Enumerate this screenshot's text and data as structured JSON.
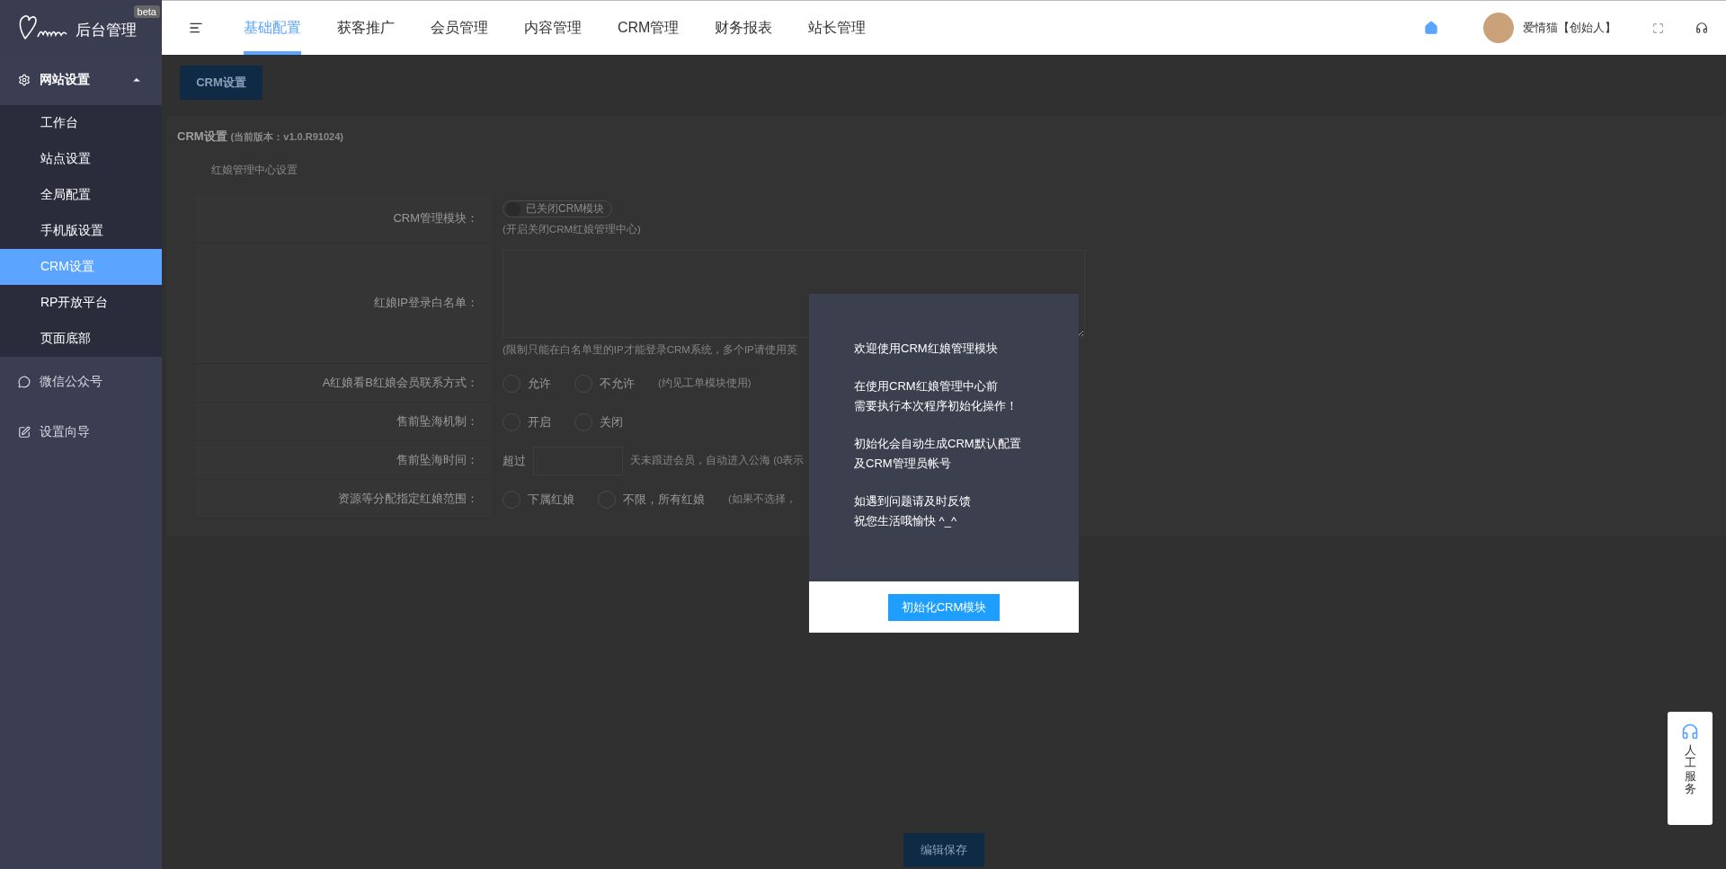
{
  "logo": {
    "text": "后台管理",
    "badge": "beta"
  },
  "top_nav": [
    {
      "label": "基础配置",
      "selected": true
    },
    {
      "label": "获客推广",
      "selected": false
    },
    {
      "label": "会员管理",
      "selected": false
    },
    {
      "label": "内容管理",
      "selected": false
    },
    {
      "label": "CRM管理",
      "selected": false
    },
    {
      "label": "财务报表",
      "selected": false
    },
    {
      "label": "站长管理",
      "selected": false
    }
  ],
  "user": {
    "name": "爱情猫【创始人】"
  },
  "sidebar": [
    {
      "label": "网站设置",
      "expanded": true,
      "children": [
        {
          "label": "工作台",
          "selected": false
        },
        {
          "label": "站点设置",
          "selected": false
        },
        {
          "label": "全局配置",
          "selected": false
        },
        {
          "label": "手机版设置",
          "selected": false
        },
        {
          "label": "CRM设置",
          "selected": true
        },
        {
          "label": "RP开放平台",
          "selected": false
        },
        {
          "label": "页面底部",
          "selected": false
        }
      ]
    },
    {
      "label": "微信公众号",
      "expanded": false
    },
    {
      "label": "设置向导",
      "expanded": false
    }
  ],
  "page_button": "CRM设置",
  "panel": {
    "title": "CRM设置",
    "version": "(当前版本：v1.0.R91024)",
    "tab": "红娘管理中心设置",
    "rows": [
      {
        "kind": "switch",
        "label": "CRM管理模块：",
        "switch_text": "已关闭CRM模块",
        "on": false,
        "hint": "(开启关闭CRM红娘管理中心)"
      },
      {
        "kind": "textarea",
        "label": "红娘IP登录白名单：",
        "hint": "(限制只能在白名单里的IP才能登录CRM系统，多个IP请使用英"
      },
      {
        "kind": "radio",
        "label": "A红娘看B红娘会员联系方式：",
        "options": [
          {
            "label": "允许",
            "selected": false
          },
          {
            "label": "不允许",
            "selected": false
          }
        ],
        "hint": "(约见工单模块使用)"
      },
      {
        "kind": "radio",
        "label": "售前坠海机制：",
        "options": [
          {
            "label": "开启",
            "selected": false
          },
          {
            "label": "关闭",
            "selected": false
          }
        ]
      },
      {
        "kind": "input",
        "label": "售前坠海时间：",
        "prefix": "超过",
        "hint": "天未跟进会员，自动进入公海 (0表示"
      },
      {
        "kind": "radio",
        "label": "资源等分配指定红娘范围：",
        "options": [
          {
            "label": "下属红娘",
            "selected": false
          },
          {
            "label": "不限，所有红娘",
            "selected": false
          }
        ],
        "hint": "(如果不选择，"
      }
    ]
  },
  "save_button": "编辑保存",
  "modal": {
    "paragraphs": [
      [
        "欢迎使用CRM红娘管理模块"
      ],
      [
        "在使用CRM红娘管理中心前",
        "需要执行本次程序初始化操作！"
      ],
      [
        "初始化会自动生成CRM默认配置",
        "及CRM管理员帐号"
      ],
      [
        "如遇到问题请及时反馈",
        "祝您生活哦愉快 ^_^"
      ]
    ],
    "button": "初始化CRM模块"
  },
  "help_button": {
    "label": "人工服务"
  }
}
